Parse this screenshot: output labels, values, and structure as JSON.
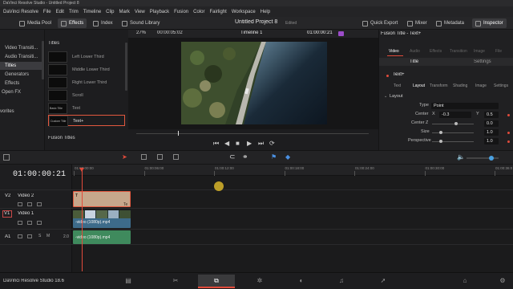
{
  "window": {
    "title": "DaVinci Resolve Studio - Untitled Project 8"
  },
  "menu": [
    "DaVinci Resolve",
    "File",
    "Edit",
    "Trim",
    "Timeline",
    "Clip",
    "Mark",
    "View",
    "Playback",
    "Fusion",
    "Color",
    "Fairlight",
    "Workspace",
    "Help"
  ],
  "toolbar": {
    "media_pool": "Media Pool",
    "effects": "Effects",
    "index": "Index",
    "sound_library": "Sound Library",
    "project_title": "Untitled Project 8",
    "edited": "Edited",
    "quick_export": "Quick Export",
    "mixer": "Mixer",
    "metadata": "Metadata",
    "inspector": "Inspector"
  },
  "effects_panel": {
    "categories": [
      "Video Transiti...",
      "Audio Transiti...",
      "Titles",
      "Generators",
      "Effects",
      "Open FX",
      "vorites"
    ],
    "selected_category": "Titles",
    "section_title": "Titles",
    "titles": [
      "Left Lower Third",
      "Middle Lower Third",
      "Right Lower Third",
      "Scroll",
      "Text",
      "Text+"
    ],
    "thumb_labels": [
      "",
      "",
      "",
      "",
      "Basic Title",
      "Custom Title"
    ],
    "fusion_section": "Fusion Titles"
  },
  "viewer": {
    "zoom": "27%",
    "source_tc": "00:00:05:02",
    "timeline_name": "Timeline 1",
    "record_tc": "01:00:00:21"
  },
  "inspector": {
    "header": "Fusion Title - Text+",
    "top_tabs": [
      "Video",
      "Audio",
      "Effects",
      "Transition",
      "Image",
      "File"
    ],
    "sub_tabs": [
      "Title",
      "Settings"
    ],
    "node_name": "Text+",
    "node_tabs": [
      "Text",
      "Layout",
      "Transform",
      "Shading",
      "Image",
      "Settings"
    ],
    "active_node_tab": "Layout",
    "section": "Layout",
    "type_label": "Type",
    "type_value": "Point",
    "center_label": "Center",
    "center_x_label": "X",
    "center_x": "-0.3",
    "center_y_label": "Y",
    "center_y": "0.5",
    "center_z_label": "Center Z",
    "center_z": "0.0",
    "size_label": "Size",
    "size": "1.0",
    "perspective_label": "Perspective",
    "perspective": "1.0"
  },
  "timeline": {
    "timecode": "01:00:00:21",
    "ruler": [
      "01:00:00:00",
      "01:00:06:00",
      "01:00:12:00",
      "01:00:18:00",
      "01:00:24:00",
      "01:00:30:00",
      "01:00:36:0"
    ],
    "tracks": [
      {
        "id": "V2",
        "name": "Video 2"
      },
      {
        "id": "V1",
        "name": "Video 1"
      },
      {
        "id": "A1",
        "name": "",
        "level": "2.0"
      }
    ],
    "clip_text_badge": "T",
    "clip_text_badge2": "Te",
    "video_clip": "-video (1080p).mp4",
    "audio_clip": "-video (1080p).mp4",
    "audio_label": "A1"
  },
  "footer": {
    "app": "DaVinci Resolve Studio 18.6"
  },
  "colors": {
    "accent": "#e24b3b",
    "text_clip": "#c7a78b",
    "video_clip": "#3d6b8a",
    "audio_clip": "#3f8a5d",
    "playhead": "#e24b3b"
  }
}
